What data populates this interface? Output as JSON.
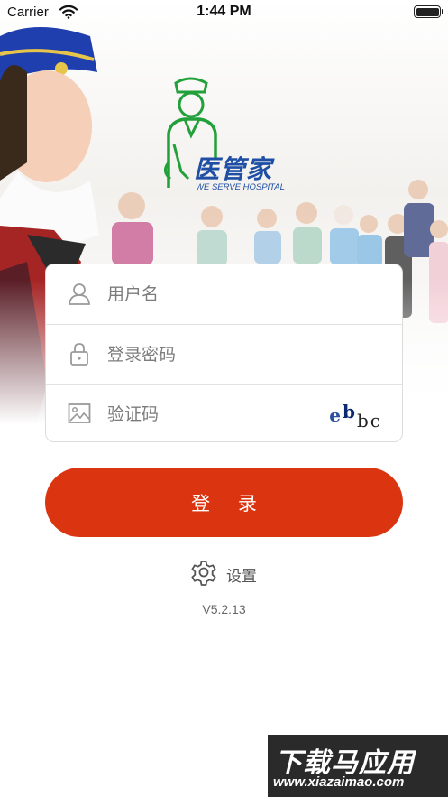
{
  "status_bar": {
    "carrier": "Carrier",
    "time": "1:44 PM",
    "wifi_icon": "wifi-icon",
    "battery_icon": "battery-icon"
  },
  "logo": {
    "title": "医管家",
    "subtitle": "WE SERVE HOSPITAL",
    "icon": "nurse-logo-icon"
  },
  "login_form": {
    "username": {
      "placeholder": "用户名",
      "value": "",
      "icon": "user-icon"
    },
    "password": {
      "placeholder": "登录密码",
      "value": "",
      "icon": "lock-icon"
    },
    "captcha": {
      "placeholder": "验证码",
      "value": "",
      "icon": "image-icon",
      "code": [
        "e",
        "b",
        "b",
        "c"
      ]
    },
    "submit_label": "登 录"
  },
  "settings": {
    "label": "设置",
    "icon": "gear-icon"
  },
  "version": "V5.2.13",
  "watermark": {
    "title": "下载马应用",
    "url": "www.xiazaimao.com"
  },
  "colors": {
    "accent": "#da3510",
    "logo_green": "#22a03a",
    "logo_blue": "#1f4fa5",
    "border": "#dcdcdc"
  }
}
